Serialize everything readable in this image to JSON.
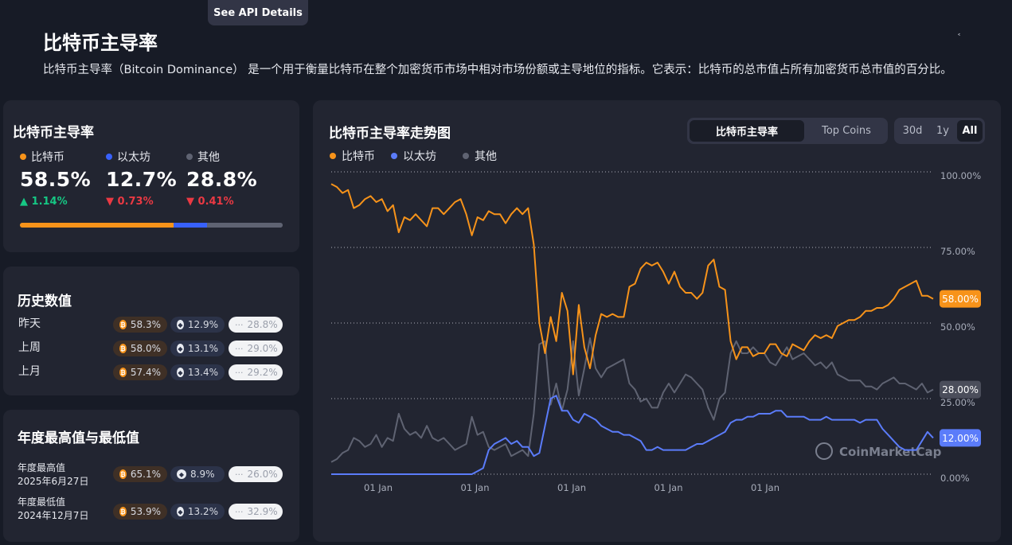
{
  "header": {
    "tooltip_button": "See API Details",
    "title": "比特币主导率",
    "description": "比特币主导率（Bitcoin Dominance） 是一个用于衡量比特币在整个加密货币市场中相对市场份额或主导地位的指标。它表示：比特币的总市值占所有加密货币总市值的百分比。"
  },
  "dominance_card": {
    "title": "比特币主导率",
    "items": [
      {
        "label": "比特币",
        "value": "58.5%",
        "change": "1.14%",
        "direction": "up",
        "color": "#f7931a"
      },
      {
        "label": "以太坊",
        "value": "12.7%",
        "change": "0.73%",
        "direction": "down",
        "color": "#3861fb"
      },
      {
        "label": "其他",
        "value": "28.8%",
        "change": "0.41%",
        "direction": "down",
        "color": "#5f6372"
      }
    ],
    "bar": [
      58.5,
      12.7,
      28.8
    ]
  },
  "history_card": {
    "title": "历史数值",
    "rows": [
      {
        "label": "昨天",
        "btc": "58.3%",
        "eth": "12.9%",
        "other": "28.8%"
      },
      {
        "label": "上周",
        "btc": "58.0%",
        "eth": "13.1%",
        "other": "29.0%"
      },
      {
        "label": "上月",
        "btc": "57.4%",
        "eth": "13.4%",
        "other": "29.2%"
      }
    ]
  },
  "yearly_card": {
    "title": "年度最高值与最低值",
    "rows": [
      {
        "label": "年度最高值",
        "date": "2025年6月27日",
        "btc": "65.1%",
        "eth": "8.9%",
        "other": "26.0%"
      },
      {
        "label": "年度最低值",
        "date": "2024年12月7日",
        "btc": "53.9%",
        "eth": "13.2%",
        "other": "32.9%"
      }
    ]
  },
  "chart_card": {
    "title": "比特币主导率走势图",
    "toggle": [
      "比特币主导率",
      "Top Coins"
    ],
    "ranges": [
      "30d",
      "1y",
      "All"
    ],
    "active_range": "All",
    "legend": [
      "比特币",
      "以太坊",
      "其他"
    ],
    "watermark": "CoinMarketCap",
    "current_labels": {
      "btc": "58.00%",
      "other": "28.00%",
      "eth": "12.00%"
    }
  },
  "icons": {
    "coin_btc": "bitcoin-icon",
    "coin_eth": "ethereum-icon",
    "other": "more-dots-icon"
  },
  "chart_data": {
    "type": "line",
    "title": "比特币主导率走势图",
    "x_tick_labels": [
      "01 Jan",
      "01 Jan",
      "01 Jan",
      "01 Jan",
      "01 Jan"
    ],
    "y_tick_labels": [
      "100.00%",
      "75.00%",
      "50.00%",
      "25.00%",
      "0.00%"
    ],
    "ylim": [
      0,
      100
    ],
    "grid": true,
    "legend_position": "top-left",
    "series": [
      {
        "name": "比特币",
        "color": "#f7931a",
        "values": [
          96,
          95,
          93,
          94,
          88,
          89,
          91,
          92,
          90,
          91,
          87,
          89,
          80,
          85,
          84,
          86,
          84,
          82,
          88,
          88,
          86,
          88,
          90,
          91,
          86,
          79,
          85,
          84,
          87,
          86,
          86,
          83,
          86,
          88,
          86,
          88,
          76,
          50,
          40,
          52,
          44,
          60,
          54,
          33,
          56,
          42,
          35,
          46,
          53,
          52,
          53,
          52,
          52,
          62,
          63,
          68,
          70,
          69,
          70,
          67,
          63,
          67,
          62,
          60,
          60,
          58,
          60,
          69,
          71,
          62,
          61,
          44,
          38,
          42,
          42,
          39,
          40,
          40,
          43,
          43,
          40,
          39,
          43,
          42,
          41,
          44,
          46,
          45,
          46,
          45,
          49,
          50,
          51,
          51,
          52,
          54,
          54,
          55,
          55,
          56,
          58,
          61,
          62,
          63,
          64,
          59,
          59,
          58
        ]
      },
      {
        "name": "以太坊",
        "color": "#3861fb",
        "values": [
          0,
          0,
          0,
          0,
          0,
          0,
          0,
          0,
          0,
          0,
          0,
          0,
          0,
          0,
          0,
          0,
          0,
          0,
          0,
          0,
          0,
          0,
          0,
          0,
          0,
          0,
          1,
          2,
          8,
          10,
          11,
          12,
          10,
          11,
          9,
          9,
          6,
          7,
          16,
          25,
          26,
          21,
          21,
          18,
          17,
          20,
          19,
          18,
          16,
          15,
          14,
          14,
          13,
          13,
          12,
          11,
          8,
          8,
          9,
          8,
          8,
          8,
          8,
          8,
          9,
          10,
          10,
          11,
          12,
          13,
          14,
          17,
          18,
          18,
          19,
          19,
          20,
          20,
          20,
          21,
          21,
          19,
          19,
          19,
          19,
          18,
          18,
          18,
          19,
          18,
          18,
          18,
          18,
          18,
          17,
          18,
          18,
          18,
          15,
          13,
          11,
          9,
          8,
          8,
          8,
          11,
          14,
          12
        ]
      },
      {
        "name": "其他",
        "color": "#5f6372",
        "values": [
          4,
          5,
          7,
          8,
          12,
          11,
          9,
          10,
          13,
          9,
          12,
          11,
          20,
          15,
          13,
          14,
          12,
          16,
          12,
          11,
          12,
          10,
          8,
          9,
          10,
          19,
          13,
          14,
          9,
          8,
          9,
          10,
          6,
          7,
          8,
          6,
          20,
          43,
          44,
          23,
          30,
          21,
          28,
          44,
          26,
          35,
          45,
          35,
          32,
          35,
          36,
          37,
          38,
          30,
          28,
          24,
          25,
          22,
          22,
          27,
          30,
          27,
          30,
          33,
          32,
          30,
          28,
          22,
          18,
          25,
          27,
          40,
          44,
          40,
          40,
          42,
          40,
          40,
          37,
          36,
          39,
          42,
          38,
          39,
          40,
          38,
          36,
          37,
          35,
          37,
          33,
          32,
          31,
          31,
          31,
          29,
          29,
          28,
          30,
          31,
          32,
          30,
          30,
          29,
          28,
          30,
          27,
          28
        ]
      }
    ]
  }
}
